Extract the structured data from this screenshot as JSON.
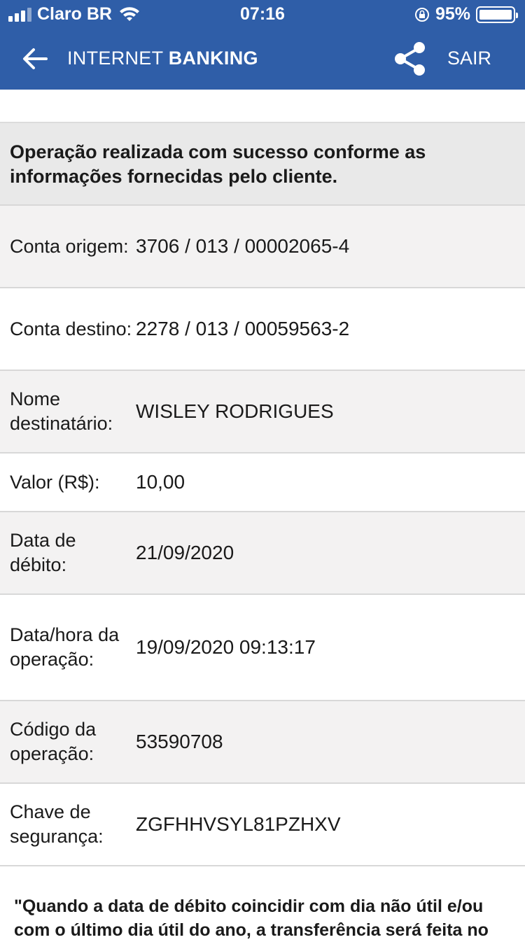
{
  "status": {
    "carrier": "Claro BR",
    "time": "07:16",
    "battery": "95%"
  },
  "header": {
    "title_prefix": "INTERNET",
    "title_bold": "BANKING",
    "logout_label": "SAIR"
  },
  "icons": {
    "back": "arrow-left-icon",
    "share": "share-icon"
  },
  "banner": {
    "message": "Operação realizada com sucesso conforme as informações fornecidas pelo cliente."
  },
  "rows": [
    {
      "label": "Conta origem:",
      "value": "3706 / 013 / 00002065-4"
    },
    {
      "label": "Conta destino:",
      "value": "2278 / 013 / 00059563-2"
    },
    {
      "label": "Nome destinatário:",
      "value": "WISLEY RODRIGUES"
    },
    {
      "label": "Valor (R$):",
      "value": "10,00"
    },
    {
      "label": "Data de débito:",
      "value": "21/09/2020"
    },
    {
      "label": "Data/hora da operação:",
      "value": "19/09/2020 09:13:17"
    },
    {
      "label": "Código da operação:",
      "value": "53590708"
    },
    {
      "label": "Chave de segurança:",
      "value": "ZGFHHVSYL81PZHXV"
    }
  ],
  "note": "\"Quando a data de débito coincidir com dia não útil e/ou com o último dia útil do ano, a transferência será feita no"
}
